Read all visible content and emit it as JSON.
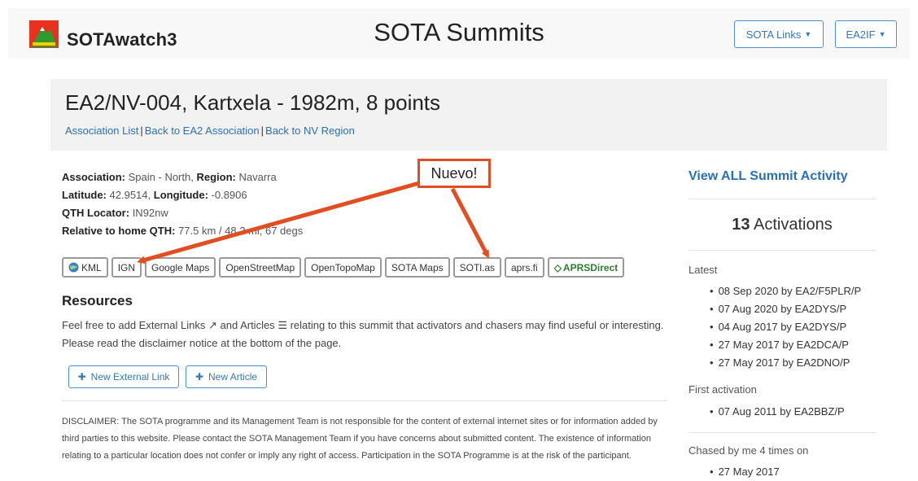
{
  "navbar": {
    "brand": "SOTAwatch3",
    "title": "SOTA Summits",
    "links_button": "SOTA Links",
    "user_button": "EA2IF"
  },
  "summit": {
    "title": "EA2/NV-004, Kartxela - 1982m, 8 points",
    "breadcrumbs": [
      "Association List",
      "Back to EA2 Association",
      "Back to NV Region"
    ]
  },
  "details": {
    "association_label": "Association:",
    "association_value": "Spain - North,",
    "region_label": "Region:",
    "region_value": "Navarra",
    "latitude_label": "Latitude:",
    "latitude_value": "42.9514,",
    "longitude_label": "Longitude:",
    "longitude_value": "-0.8906",
    "qth_label": "QTH Locator:",
    "qth_value": "IN92nw",
    "relative_label": "Relative to home QTH:",
    "relative_value": "77.5 km / 48.2 mi, 67 degs"
  },
  "map_links": [
    "KML",
    "IGN",
    "Google Maps",
    "OpenStreetMap",
    "OpenTopoMap",
    "SOTA Maps",
    "SOTl.as",
    "aprs.fi",
    "APRSDirect"
  ],
  "resources": {
    "title": "Resources",
    "text_1": "Feel free to add External Links",
    "text_2": "and Articles",
    "text_3": "relating to this summit that activators and chasers may find useful or interesting. Please read the disclaimer notice at the bottom of the page.",
    "new_link": "New External Link",
    "new_article": "New Article"
  },
  "disclaimer": "DISCLAIMER: The SOTA programme and its Management Team is not responsible for the content of external internet sites or for information added by third parties to this website. Please contact the SOTA Management Team if you have concerns about submitted content. The existence of information relating to a particular location does not confer or imply any right of access. Participation in the SOTA Programme is at the risk of the participant.",
  "sidebar": {
    "view_all": "View ALL Summit Activity",
    "activation_count": "13",
    "activation_word": "Activations",
    "latest_label": "Latest",
    "latest": [
      "08 Sep 2020 by EA2/F5PLR/P",
      "07 Aug 2020 by EA2DYS/P",
      "04 Aug 2017 by EA2DYS/P",
      "27 May 2017 by EA2DCA/P",
      "27 May 2017 by EA2DNO/P"
    ],
    "first_label": "First activation",
    "first": [
      "07 Aug 2011 by EA2BBZ/P"
    ],
    "chased_label": "Chased by me 4 times on",
    "chased": [
      "27 May 2017"
    ]
  },
  "annotation": {
    "callout": "Nuevo!"
  },
  "colors": {
    "accent": "#337ab7",
    "annotation": "#e04e22",
    "aprs": "#2e7d32"
  },
  "icons": [
    "mountain-logo-icon",
    "caret-down-icon",
    "globe-icon",
    "external-link-icon",
    "list-icon",
    "plus-icon",
    "diamond-icon"
  ]
}
